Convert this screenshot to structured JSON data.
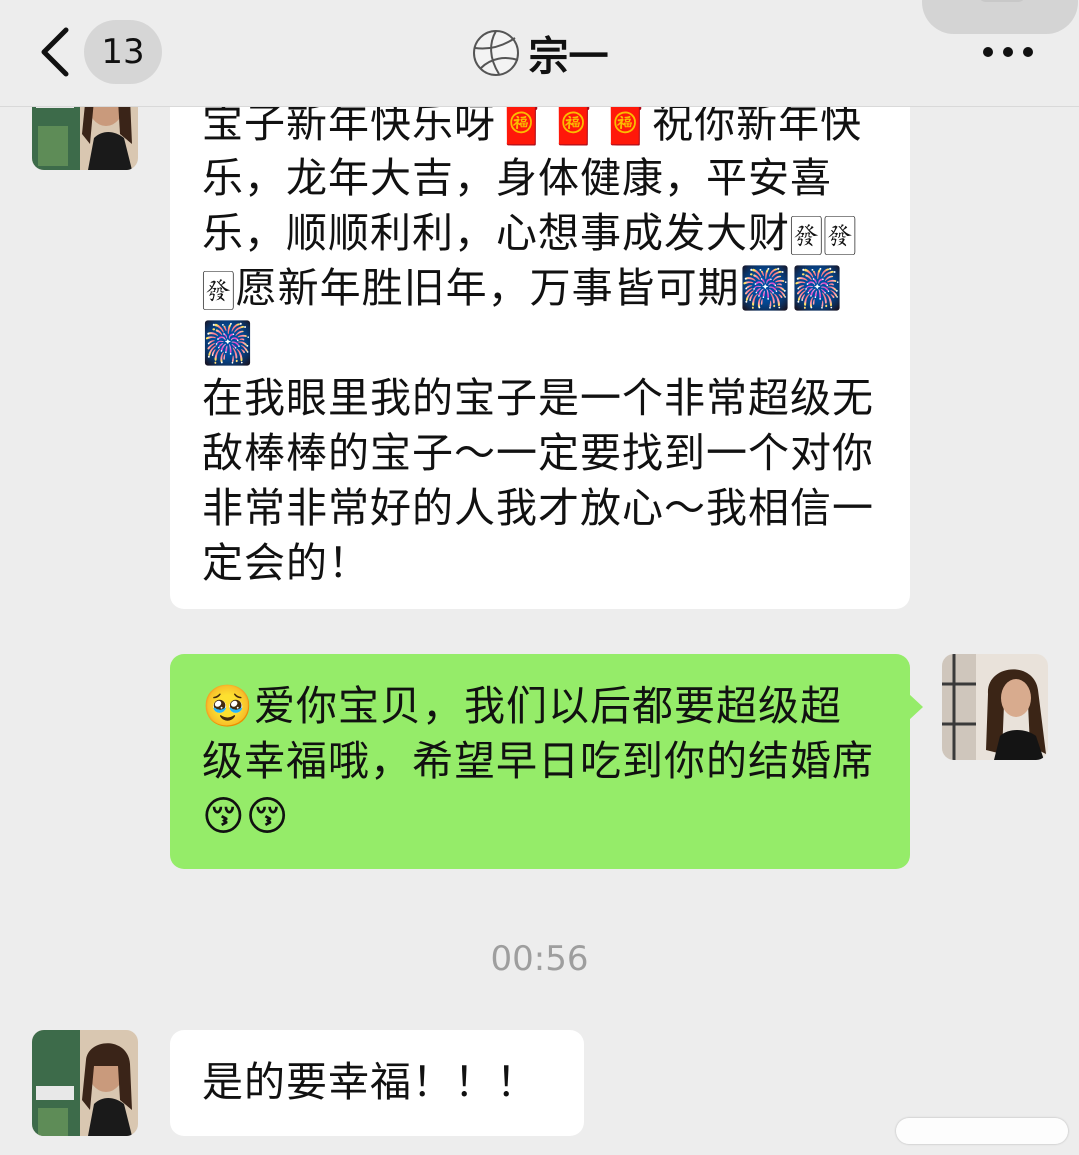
{
  "header": {
    "back_icon": "chevron-left-icon",
    "unread_count": "13",
    "title_icon": "volleyball-icon",
    "title": "宗一",
    "more_icon": "more-dots-icon"
  },
  "messages": [
    {
      "sender": "contact",
      "text": "宝子新年快乐呀🧧🧧🧧祝你新年快乐，龙年大吉，身体健康，平安喜乐，顺顺利利，心想事成发大财🀅🀅🀅愿新年胜旧年，万事皆可期🎆🎆🎆\n在我眼里我的宝子是一个非常超级无敌棒棒的宝子～一定要找到一个对你非常非常好的人我才放心～我相信一定会的！"
    },
    {
      "sender": "me",
      "text": "🥹爱你宝贝，我们以后都要超级超级幸福哦，希望早日吃到你的结婚席😚😚"
    },
    {
      "sender": "contact",
      "text": "是的要幸福！！！"
    }
  ],
  "timestamp": "00:56",
  "colors": {
    "background": "#ededed",
    "incoming_bubble": "#ffffff",
    "outgoing_bubble": "#95ec69",
    "timestamp": "#9e9e9e"
  }
}
